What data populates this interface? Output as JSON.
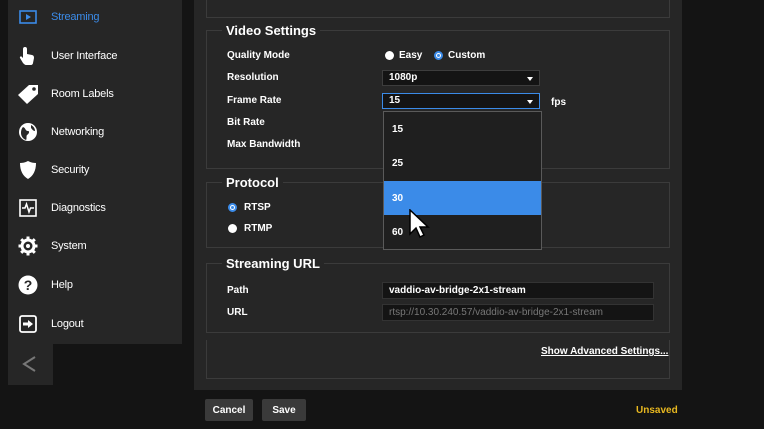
{
  "sidebar": {
    "items": [
      {
        "label": "Streaming",
        "icon": "play-icon",
        "active": true
      },
      {
        "label": "User Interface",
        "icon": "hand-pointer-icon"
      },
      {
        "label": "Room Labels",
        "icon": "tag-icon"
      },
      {
        "label": "Networking",
        "icon": "globe-icon"
      },
      {
        "label": "Security",
        "icon": "shield-icon"
      },
      {
        "label": "Diagnostics",
        "icon": "pulse-icon"
      },
      {
        "label": "System",
        "icon": "gear-icon"
      },
      {
        "label": "Help",
        "icon": "question-icon"
      },
      {
        "label": "Logout",
        "icon": "logout-icon"
      }
    ],
    "collapse_icon": "chevron-left-icon"
  },
  "video_settings": {
    "title": "Video Settings",
    "quality_mode": {
      "label": "Quality Mode",
      "options": [
        "Easy",
        "Custom"
      ],
      "selected": "Custom"
    },
    "resolution": {
      "label": "Resolution",
      "value": "1080p"
    },
    "frame_rate": {
      "label": "Frame Rate",
      "value": "15",
      "unit": "fps",
      "options": [
        "15",
        "25",
        "30",
        "60"
      ],
      "highlighted": "30"
    },
    "bit_rate": {
      "label": "Bit Rate"
    },
    "max_bandwidth": {
      "label": "Max Bandwidth"
    }
  },
  "protocol": {
    "title": "Protocol",
    "options": [
      "RTSP",
      "RTMP"
    ],
    "selected": "RTSP"
  },
  "streaming_url": {
    "title": "Streaming URL",
    "path_label": "Path",
    "path_value": "vaddio-av-bridge-2x1-stream",
    "url_label": "URL",
    "url_value": "rtsp://10.30.240.57/vaddio-av-bridge-2x1-stream"
  },
  "advanced_link": "Show Advanced Settings...",
  "footer": {
    "cancel": "Cancel",
    "save": "Save",
    "status": "Unsaved"
  },
  "colors": {
    "accent": "#3b8be8",
    "unsaved": "#e8b820",
    "panel": "#262626",
    "background": "#141414"
  }
}
